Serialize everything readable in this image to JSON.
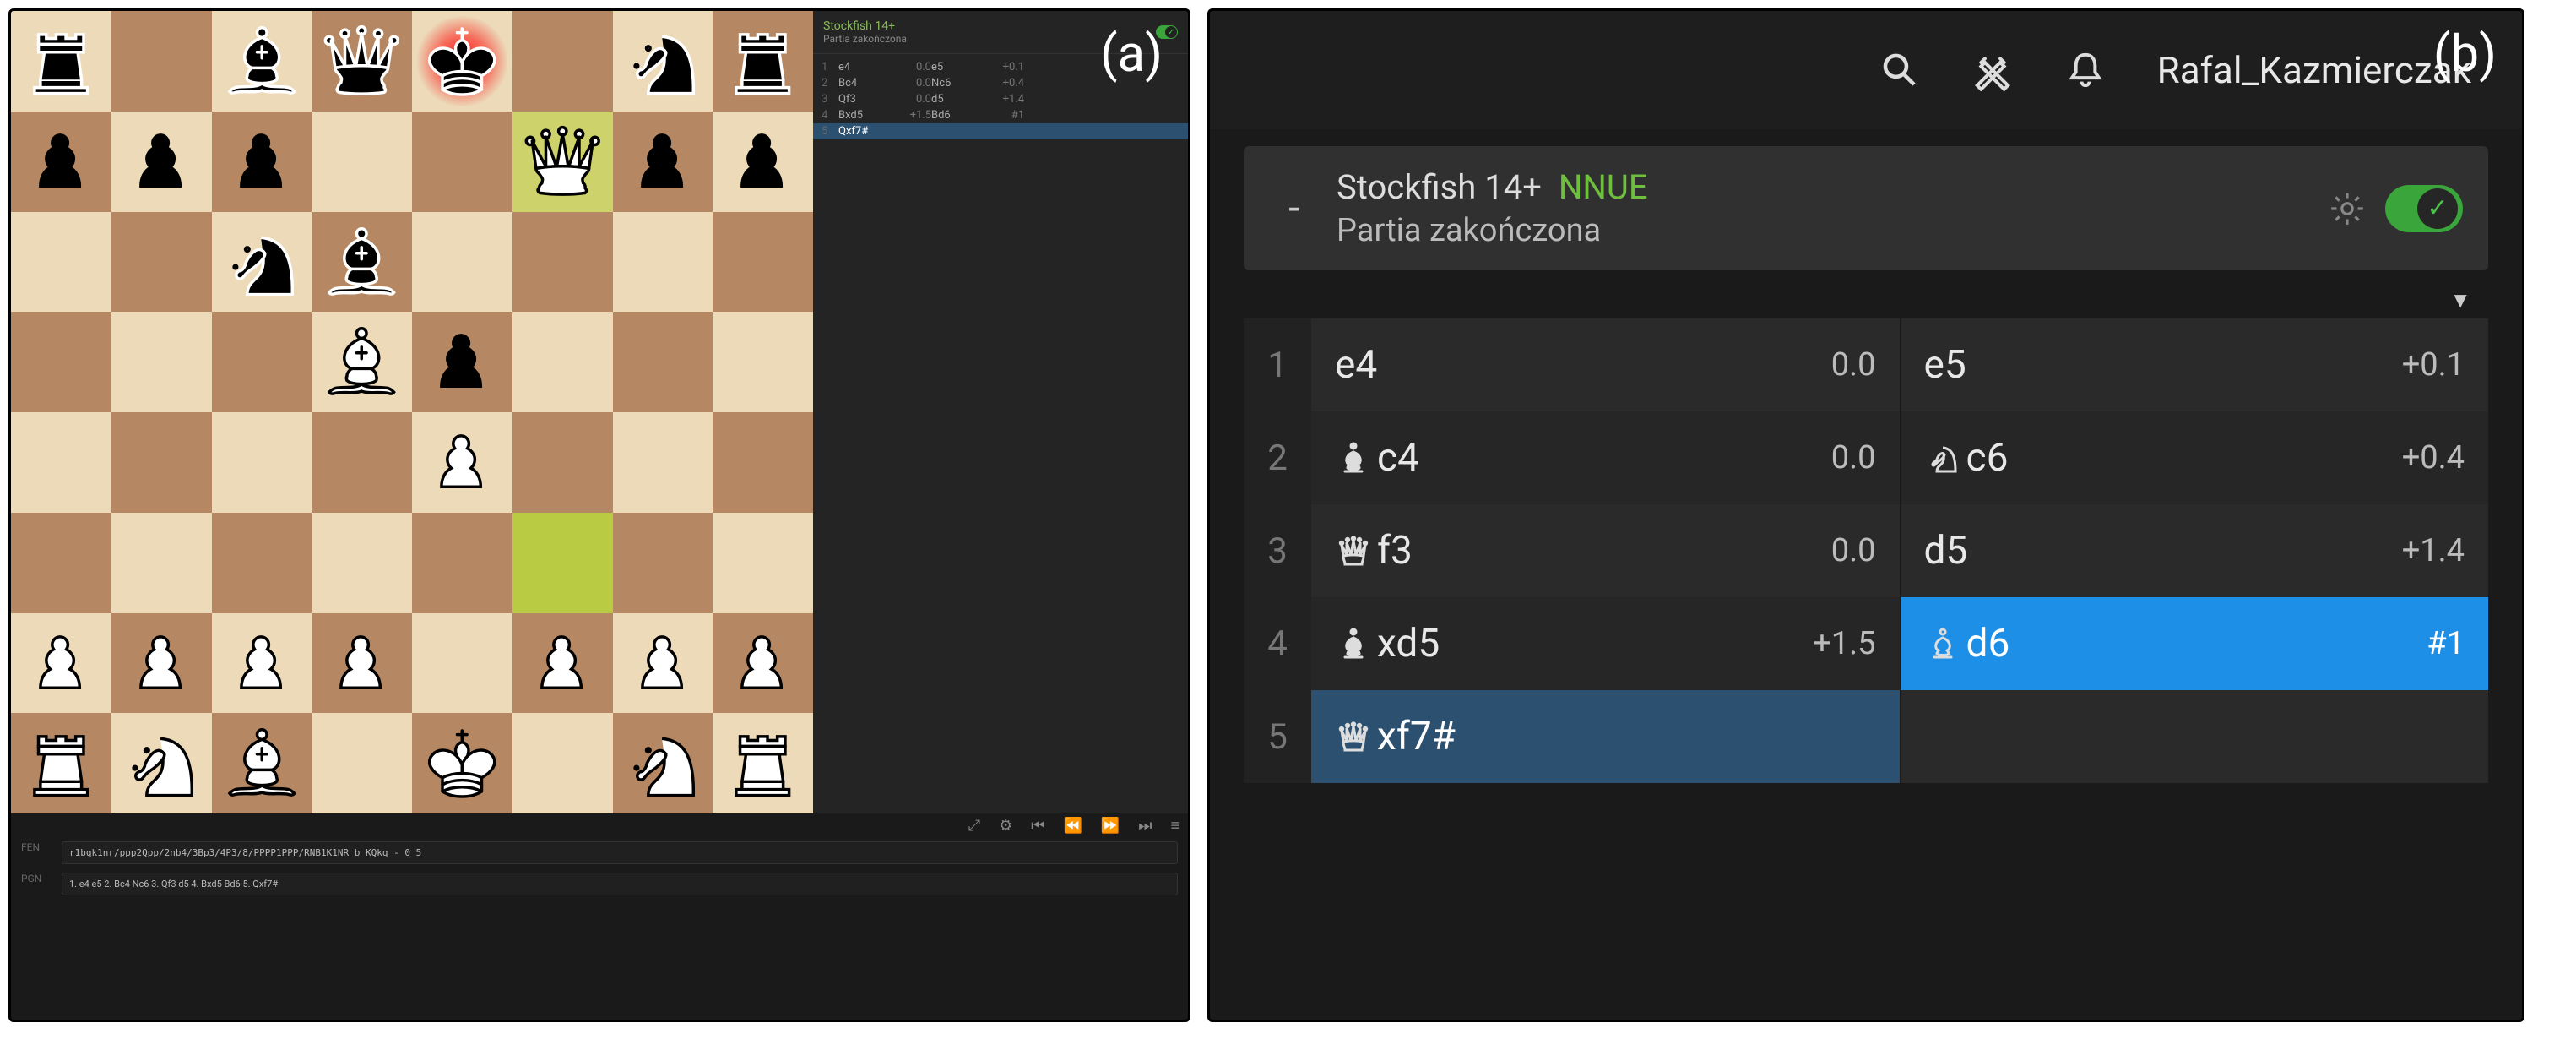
{
  "figure_labels": {
    "a": "(a)",
    "b": "(b)"
  },
  "panel_a": {
    "board": {
      "highlight_from": "f3",
      "highlight_to": "f7",
      "check_square": "e8",
      "pieces": [
        {
          "sq": "a8",
          "piece": "r",
          "color": "b"
        },
        {
          "sq": "c8",
          "piece": "b",
          "color": "b"
        },
        {
          "sq": "d8",
          "piece": "q",
          "color": "b"
        },
        {
          "sq": "e8",
          "piece": "k",
          "color": "b"
        },
        {
          "sq": "g8",
          "piece": "n",
          "color": "b"
        },
        {
          "sq": "h8",
          "piece": "r",
          "color": "b"
        },
        {
          "sq": "a7",
          "piece": "p",
          "color": "b"
        },
        {
          "sq": "b7",
          "piece": "p",
          "color": "b"
        },
        {
          "sq": "c7",
          "piece": "p",
          "color": "b"
        },
        {
          "sq": "f7",
          "piece": "q",
          "color": "w"
        },
        {
          "sq": "g7",
          "piece": "p",
          "color": "b"
        },
        {
          "sq": "h7",
          "piece": "p",
          "color": "b"
        },
        {
          "sq": "c6",
          "piece": "n",
          "color": "b"
        },
        {
          "sq": "d6",
          "piece": "b",
          "color": "b"
        },
        {
          "sq": "d5",
          "piece": "b",
          "color": "w"
        },
        {
          "sq": "e5",
          "piece": "p",
          "color": "b"
        },
        {
          "sq": "e4",
          "piece": "p",
          "color": "w"
        },
        {
          "sq": "a2",
          "piece": "p",
          "color": "w"
        },
        {
          "sq": "b2",
          "piece": "p",
          "color": "w"
        },
        {
          "sq": "c2",
          "piece": "p",
          "color": "w"
        },
        {
          "sq": "d2",
          "piece": "p",
          "color": "w"
        },
        {
          "sq": "f2",
          "piece": "p",
          "color": "w"
        },
        {
          "sq": "g2",
          "piece": "p",
          "color": "w"
        },
        {
          "sq": "h2",
          "piece": "p",
          "color": "w"
        },
        {
          "sq": "a1",
          "piece": "r",
          "color": "w"
        },
        {
          "sq": "b1",
          "piece": "n",
          "color": "w"
        },
        {
          "sq": "c1",
          "piece": "b",
          "color": "w"
        },
        {
          "sq": "e1",
          "piece": "k",
          "color": "w"
        },
        {
          "sq": "g1",
          "piece": "n",
          "color": "w"
        },
        {
          "sq": "h1",
          "piece": "r",
          "color": "w"
        }
      ]
    },
    "side": {
      "engine_name": "Stockfish 14+",
      "status": "Partia zakończona",
      "mini_moves": [
        {
          "n": "1",
          "w": "e4",
          "we": "0.0",
          "b": "e5",
          "be": "+0.1"
        },
        {
          "n": "2",
          "w": "Bc4",
          "we": "0.0",
          "b": "Nc6",
          "be": "+0.4"
        },
        {
          "n": "3",
          "w": "Qf3",
          "we": "0.0",
          "b": "d5",
          "be": "+1.4"
        },
        {
          "n": "4",
          "w": "Bxd5",
          "we": "+1.5",
          "b": "Bd6",
          "be": "#1"
        },
        {
          "n": "5",
          "w": "Qxf7#",
          "we": "",
          "b": "",
          "be": ""
        }
      ],
      "selected_row": 5
    },
    "fen_label": "FEN",
    "fen": "r1bqk1nr/ppp2Qpp/2nb4/3Bp3/4P3/8/PPPP1PPP/RNB1K1NR b KQkq - 0 5",
    "pgn_label": "PGN",
    "pgn": "1. e4 e5 2. Bc4 Nc6 3. Qf3 d5 4. Bxd5 Bd6 5. Qxf7#",
    "controls": [
      "⤢",
      "⚙",
      "⏮",
      "⏪",
      "⏩",
      "⏭",
      "≡"
    ]
  },
  "panel_b": {
    "topbar": {
      "icons": [
        "search",
        "swords",
        "bell"
      ],
      "username": "Rafal_Kazmierczak"
    },
    "engine": {
      "eval": "-",
      "name": "Stockfish 14+",
      "tag": "NNUE",
      "status": "Partia zakończona"
    },
    "moves": [
      {
        "n": "1",
        "w": {
          "san": "e4",
          "icon": "",
          "eval": "0.0"
        },
        "b": {
          "san": "e5",
          "icon": "",
          "eval": "+0.1"
        }
      },
      {
        "n": "2",
        "w": {
          "san": "c4",
          "icon": "bishop",
          "eval": "0.0"
        },
        "b": {
          "san": "c6",
          "icon": "knight",
          "eval": "+0.4"
        }
      },
      {
        "n": "3",
        "w": {
          "san": "f3",
          "icon": "queen",
          "eval": "0.0"
        },
        "b": {
          "san": "d5",
          "icon": "",
          "eval": "+1.4"
        }
      },
      {
        "n": "4",
        "w": {
          "san": "xd5",
          "icon": "bishop",
          "eval": "+1.5"
        },
        "b": {
          "san": "d6",
          "icon": "bishop",
          "eval": "#1",
          "sel": "blue"
        }
      },
      {
        "n": "5",
        "w": {
          "san": "xf7#",
          "icon": "queen",
          "eval": "",
          "sel": "navy"
        },
        "b": null
      }
    ]
  }
}
